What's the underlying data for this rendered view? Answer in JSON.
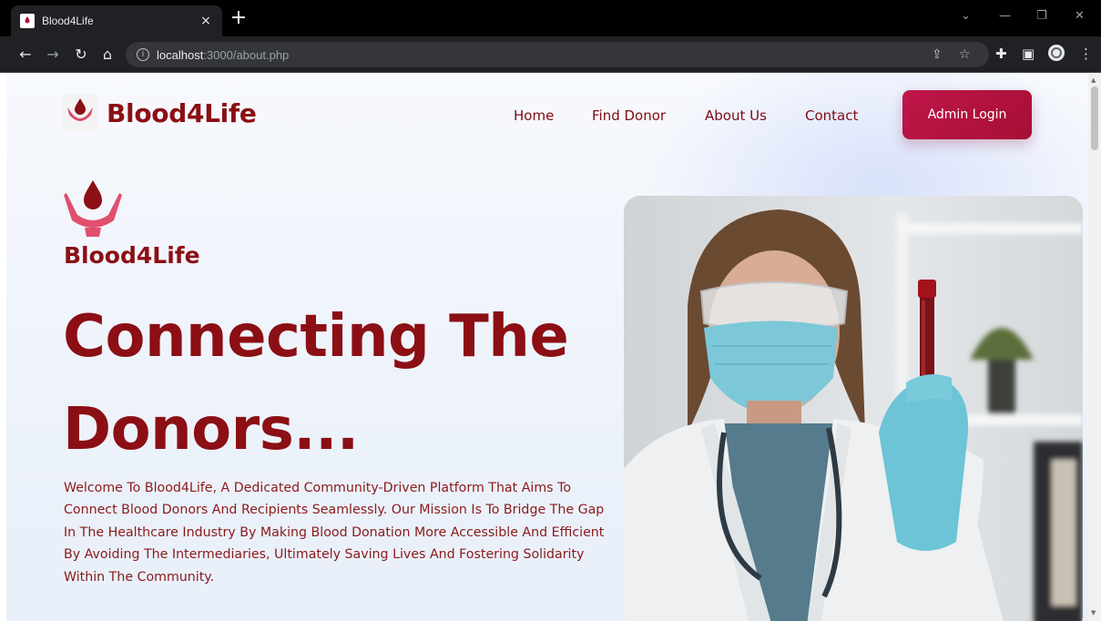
{
  "browser": {
    "tab_title": "Blood4Life",
    "tab_close": "×",
    "new_tab": "+",
    "url_host": "localhost",
    "url_path": ":3000/about.php"
  },
  "site": {
    "brand": "Blood4Life",
    "nav": [
      {
        "label": "Home"
      },
      {
        "label": "Find Donor"
      },
      {
        "label": "About Us"
      },
      {
        "label": "Contact"
      }
    ],
    "admin_button": "Admin Login"
  },
  "hero": {
    "brand": "Blood4Life",
    "headline_line1": "Connecting The",
    "headline_line2": "Donors...",
    "intro": "Welcome To Blood4Life, A Dedicated Community-Driven Platform That Aims To Connect Blood Donors And Recipients Seamlessly. Our Mission Is To Bridge The Gap In The Healthcare Industry By Making Blood Donation More Accessible And Efficient By Avoiding The Intermediaries, Ultimately Saving Lives And Fostering Solidarity Within The Community."
  },
  "colors": {
    "brand": "#8b0f14",
    "button": "#b3123f"
  }
}
